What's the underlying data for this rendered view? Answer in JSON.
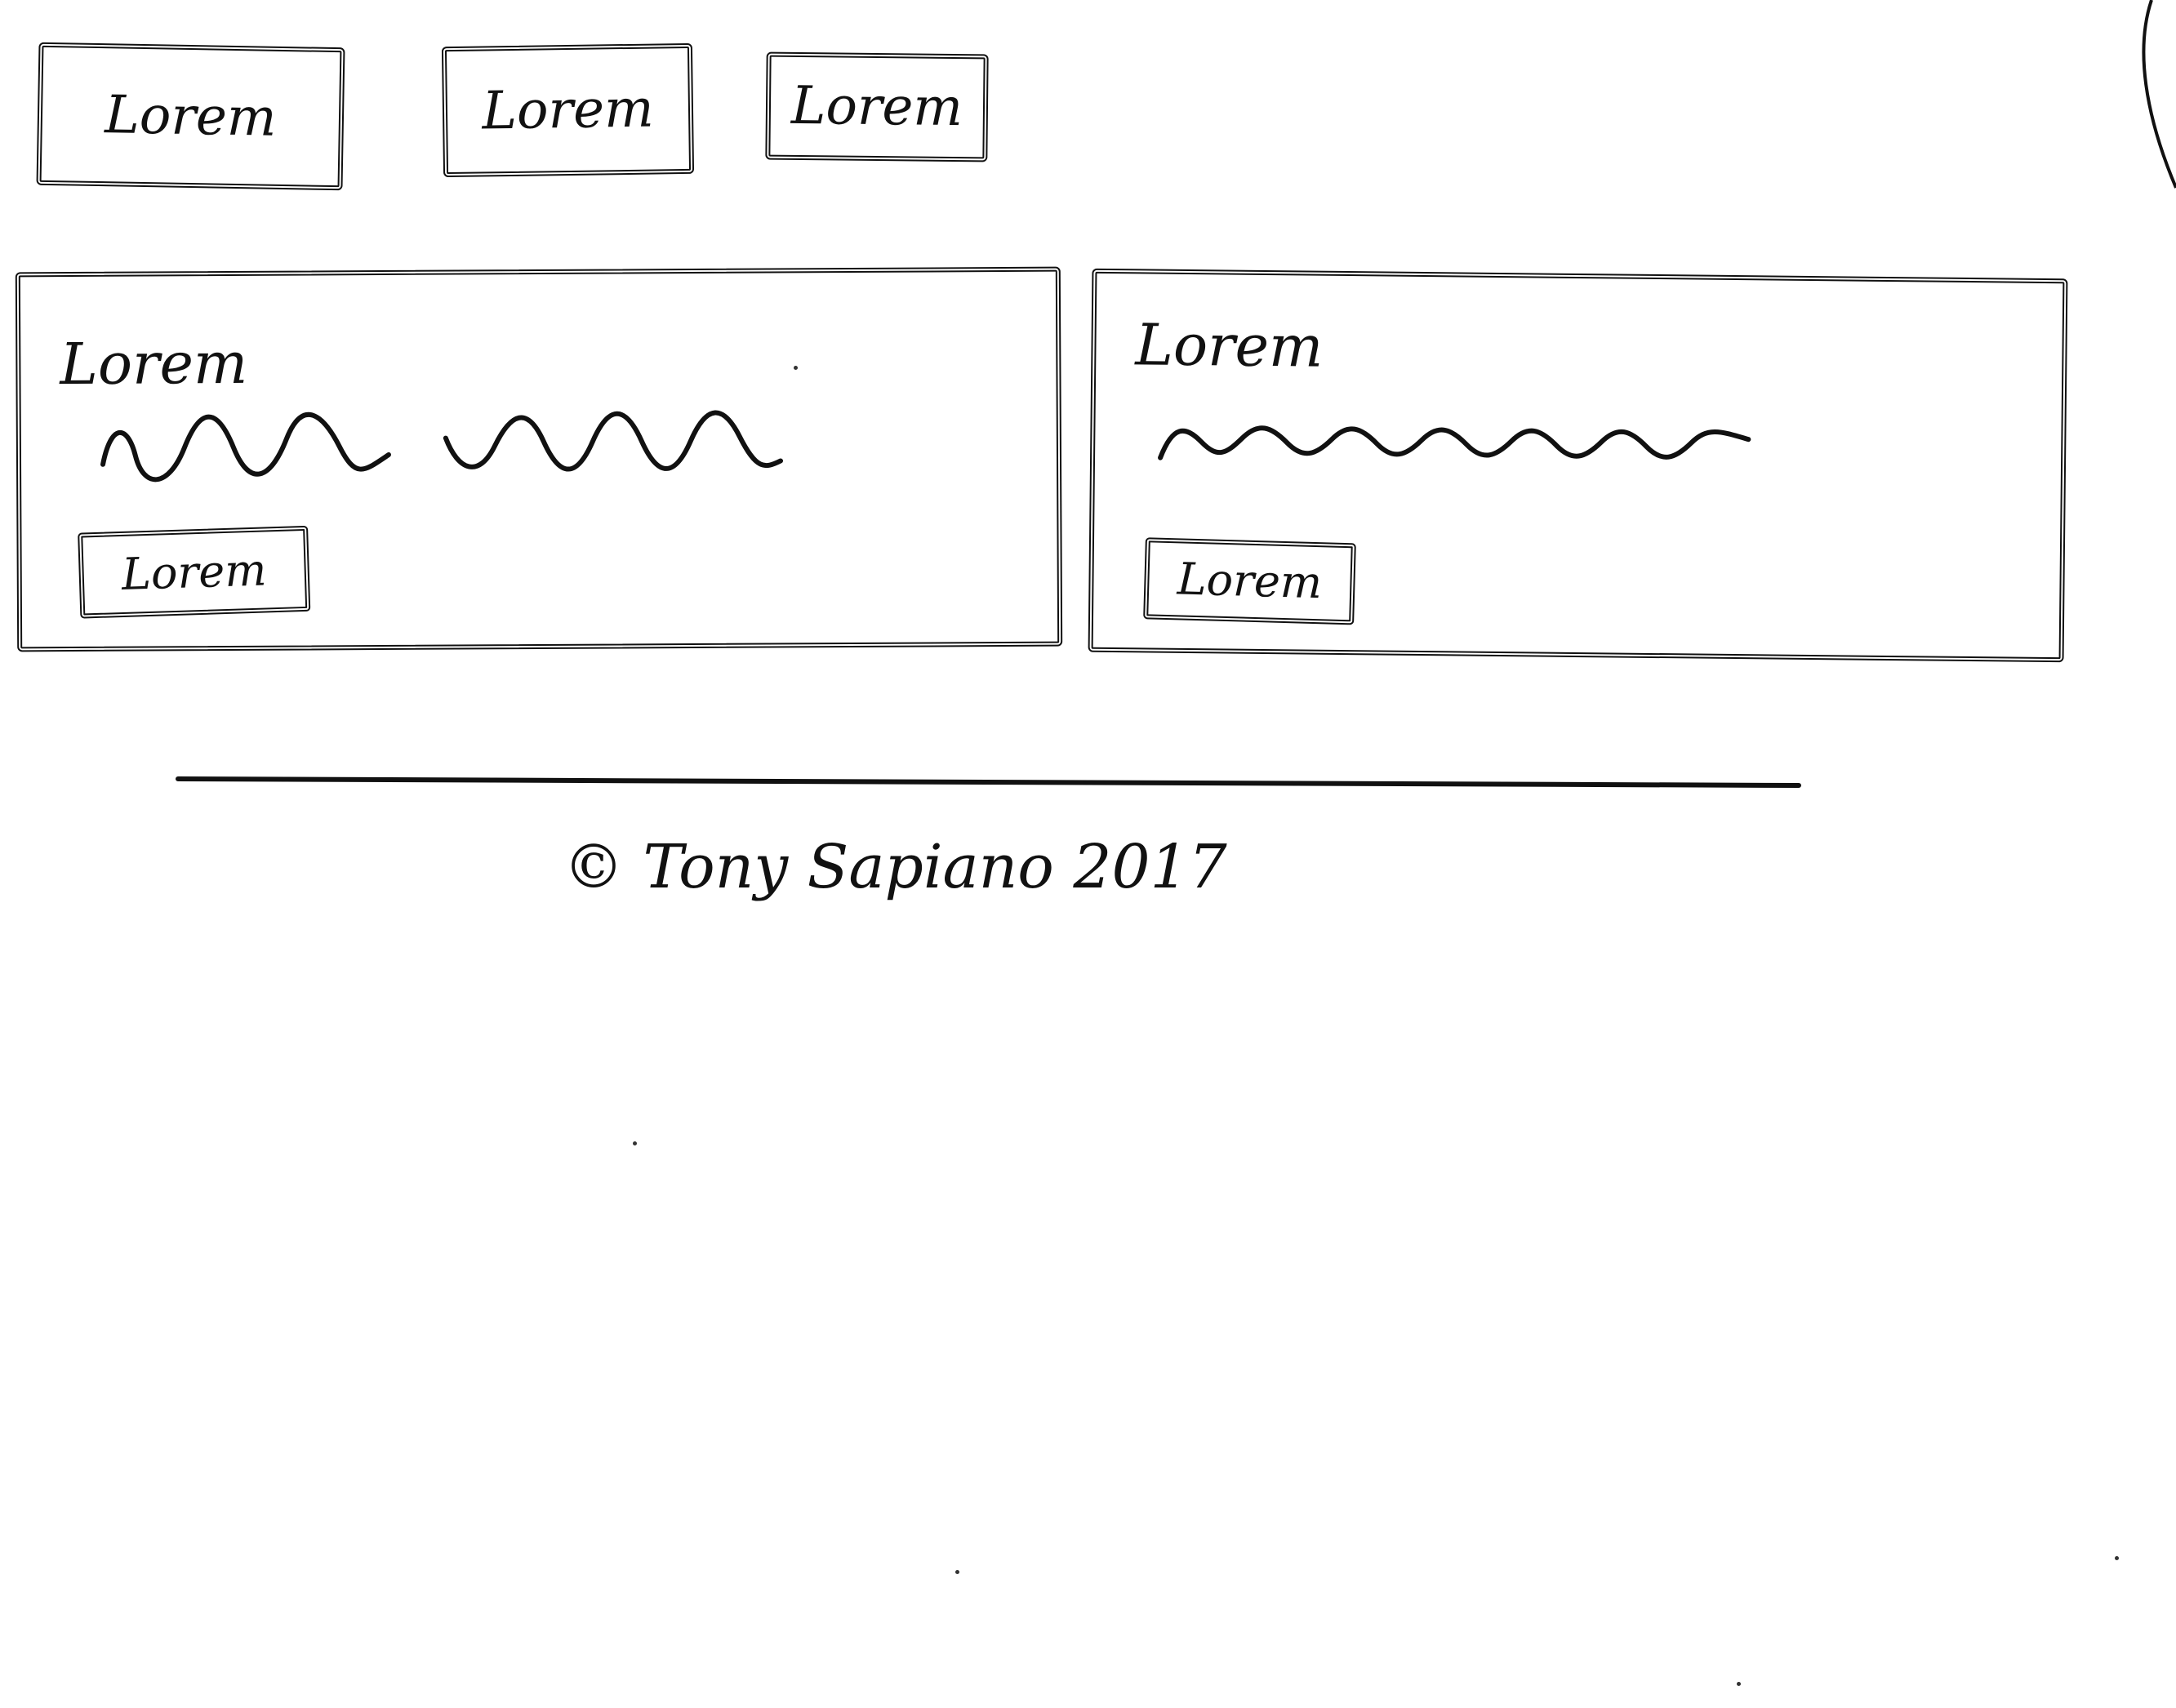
{
  "header": {
    "nav_buttons": [
      "Lorem",
      "Lorem",
      "Lorem"
    ]
  },
  "cards": [
    {
      "title": "Lorem",
      "button_label": "Lorem"
    },
    {
      "title": "Lorem",
      "button_label": "Lorem"
    }
  ],
  "footer": {
    "copyright": "© Tony Sapiano 2017"
  },
  "colors": {
    "ink": "#111111",
    "paper": "#ffffff"
  }
}
